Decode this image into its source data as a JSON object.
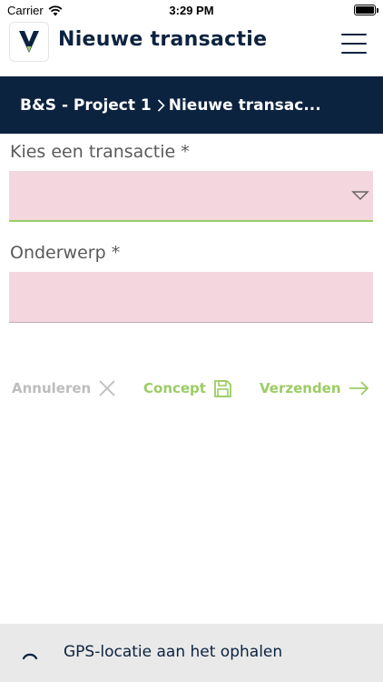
{
  "status_bar": {
    "carrier": "Carrier",
    "time": "3:29 PM"
  },
  "header": {
    "logo_letter": "V",
    "title": "Nieuwe transactie",
    "menu_icon": "hamburger-icon"
  },
  "breadcrumb": {
    "project": "B&S - Project 1",
    "current": "Nieuwe transac..."
  },
  "form": {
    "transaction_label": "Kies een transactie *",
    "transaction_value": "",
    "subject_label": "Onderwerp *",
    "subject_value": ""
  },
  "actions": {
    "cancel_label": "Annuleren",
    "concept_label": "Concept",
    "send_label": "Verzenden"
  },
  "footer": {
    "gps_status": "GPS-locatie aan het ophalen"
  },
  "colors": {
    "navy": "#0c2340",
    "accent_green": "#9ccc65",
    "field_pink": "#f4d7de",
    "disabled_grey": "#bdbdbd"
  }
}
